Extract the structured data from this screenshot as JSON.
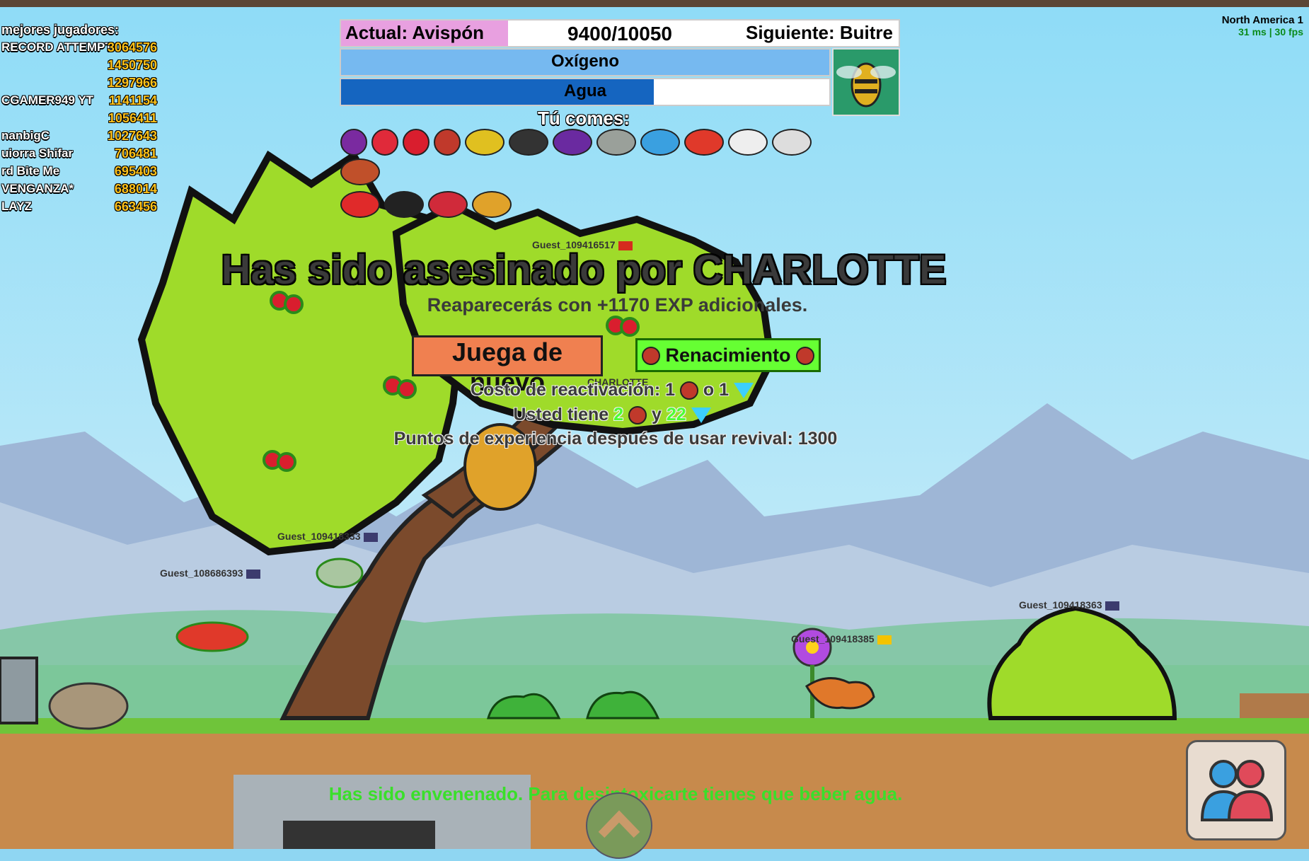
{
  "leaderboard": {
    "title": "mejores jugadores:",
    "rows": [
      {
        "name": "RECORD ATTEMPT",
        "score": "3064576"
      },
      {
        "name": "",
        "score": "1450750"
      },
      {
        "name": "",
        "score": "1297966"
      },
      {
        "name": "CGAMER949 YT",
        "score": "1141154"
      },
      {
        "name": "",
        "score": "1056411"
      },
      {
        "name": "nanbigC",
        "score": "1027643"
      },
      {
        "name": "uiorra Shifar",
        "score": "706481"
      },
      {
        "name": "rd Bite Me",
        "score": "695403"
      },
      {
        "name": "VENGANZA*",
        "score": "688014"
      },
      {
        "name": "LAYZ",
        "score": "663456"
      }
    ]
  },
  "server": {
    "name": "North America 1",
    "stats": "31 ms | 30 fps"
  },
  "xp": {
    "current_label": "Actual: Avispón",
    "count": "9400/10050",
    "next_label": "Siguiente: Buitre",
    "progress": 0.3
  },
  "oxygen": {
    "label": "Oxígeno",
    "level": 1.0
  },
  "water": {
    "label": "Agua",
    "level": 0.64
  },
  "eats": {
    "title": "Tú comes:",
    "items": [
      "eggplant-icon",
      "strawberry-icon",
      "cherry-icon",
      "woodpecker-icon",
      "bee-icon",
      "mosquito-icon",
      "fly-icon",
      "pigeon-icon",
      "bluebird-icon",
      "macaw-icon",
      "seagull-icon",
      "stork-icon",
      "chicken-icon",
      "redbird-icon",
      "penguin-icon",
      "cardinal-icon",
      "beehive-icon"
    ]
  },
  "death": {
    "killed_by": "Has sido asesinado por CHARLOTTE",
    "respawn": "Reaparecerás con +1170 EXP adicionales.",
    "play_again": "Juega de nuevo",
    "revive": "Renacimiento",
    "cost_prefix": "Costo de reactivación: 1",
    "cost_mid": "o 1",
    "have_prefix": "Usted tiene",
    "have_hearts": "2",
    "have_and": "y",
    "have_gems": "22",
    "exp_after": "Puntos de experiencia después de usar revival: 1300"
  },
  "players": [
    {
      "name": "Guest_109416517",
      "flag": "#d52b1e"
    },
    {
      "name": "Guest_109418333",
      "flag": "#3c3b6e"
    },
    {
      "name": "Guest_108686393",
      "flag": "#3c3b6e"
    },
    {
      "name": "Guest_109418363",
      "flag": "#3c3b6e"
    },
    {
      "name": "Guest_109418385",
      "flag": "#f4c300"
    },
    {
      "name": "CHARLOTTE",
      "flag": "#ffffff"
    }
  ],
  "poison_msg": "Has sido envenenado. Para desintoxicarte tienes que beber agua.",
  "colors": {
    "sky": "#8fd6f2",
    "grass": "#6fc43a",
    "dirt": "#c78a4c",
    "tree": "#9fdb2a",
    "accent_green": "#66ff33",
    "play_button": "#f08050"
  }
}
